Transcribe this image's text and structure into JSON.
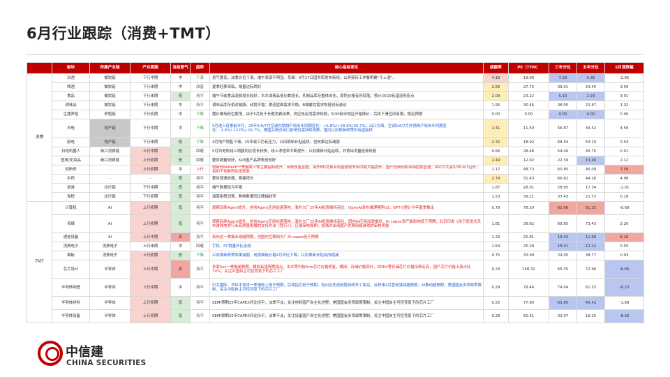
{
  "page": {
    "title": "6月行业跟踪（消费+TMT）"
  },
  "table": {
    "headers": [
      "板块",
      "所属产业链",
      "产业周期",
      "当前景气",
      "趋势",
      "核心指标变化",
      "超额率",
      "PE（TTM）",
      "三年分位",
      "五年分位",
      "5月涨跌幅"
    ],
    "sections": [
      {
        "name": "消费",
        "rows": [
          {
            "sector": "白酒",
            "chain": "餐饮链",
            "cycle": "下行中期",
            "level": "中",
            "trend": "下滑",
            "note": "景气度低，淡季价位下滑，端午表现不明显。负面：5月17日国务院发布新规，公务接待工作餐明确“不上酒”。",
            "excess": "4.18",
            "pe": "19.00",
            "p3": "7.29",
            "p5": "4.38",
            "chg": "-2.65"
          },
          {
            "sector": "啤酒",
            "chain": "餐饮链",
            "cycle": "下行末期",
            "level": "中",
            "trend": "改善",
            "note": "夏季旺季来临，销量边际转好",
            "excess": "2.66",
            "pe": "27.72",
            "p3": "39.01",
            "p5": "23.45",
            "chg": "3.59"
          },
          {
            "sector": "食品",
            "chain": "餐饮链",
            "cycle": "下行末期",
            "level": "低",
            "trend": "持平",
            "note": "端午节前食品消费增长较好，大众消费品低价数增长，乳制品库存整体去化，原奶价格有所回落；预计25Q3有望迎来拐点",
            "excess": "2.09",
            "pe": "23.22",
            "p3": "5.10",
            "p5": "2.93",
            "chg": "3.01"
          },
          {
            "sector": "调味品",
            "chain": "餐饮链",
            "cycle": "下行末期",
            "level": "中",
            "trend": "持平",
            "note": "调味品库存相对健康，动销平稳；渠道层面需求平稳，B端餐饮需求恢复较有波动",
            "excess": "1.95",
            "pe": "30.46",
            "p3": "38.05",
            "p5": "22.87",
            "chg": "1.32"
          },
          {
            "sector": "生猪养殖",
            "chain": "养殖链",
            "cycle": "下行初期",
            "level": "中",
            "trend": "下降",
            "note": "猪价维持低位震荡，由于5月处于长假消费淡季，供应充足而需求较弱，5/30部分地区开始降价，后续下滑空间有限，稳定预期",
            "excess": "0.00",
            "pe": "0.00",
            "p3": "0.00",
            "p5": "0.00",
            "chg": "0.00"
          },
          {
            "sector": "白电",
            "chain": "地产链",
            "cycle": "下行中期",
            "level": "中",
            "trend": "下降",
            "note": "5月进入旺季前半月，25年5/6/7月空调内销排产较去年同期变化：+5.8%/+28.8%/36.7%；出口方面，空调5/6/7月外销排产较去年同期变化：-1.6%/-12.0%/-16.7%。美国关税对出口影响仍需持续观察，国内以旧换新政策仍有望延续",
            "excess": "2.41",
            "pe": "11.50",
            "p3": "56.87",
            "p5": "34.52",
            "chg": "4.59"
          },
          {
            "sector": "厨电",
            "chain": "地产链",
            "cycle": "下行末期",
            "level": "低",
            "trend": "下降",
            "note": "4月地产销售下滑，25年竣工仍有压力，以旧换新补贴延续，但效果边际减弱",
            "excess": "2.32",
            "pe": "18.92",
            "p3": "68.54",
            "p5": "53.10",
            "chg": "0.54"
          },
          {
            "sector": "扫地机器人",
            "chain": "新兴消费链",
            "cycle": "上行中期",
            "level": "低",
            "trend": "回暖",
            "note": "5月扫地机线上销额同比增长较快，线上渗透率不断提升，以旧换新补贴延续，外销出货量逐渐恢复",
            "excess": "0.66",
            "pe": "28.48",
            "p3": "54.40",
            "p5": "45.75",
            "chg": "0.01"
          },
          {
            "sector": "医美/化妆品",
            "chain": "新兴消费链",
            "cycle": "上行初期",
            "level": "低",
            "trend": "回暖",
            "note": "整体销量较好，618国产品牌表现较好",
            "excess": "2.49",
            "pe": "12.92",
            "p3": "22.39",
            "p5": "13.46",
            "chg": "2.12"
          },
          {
            "sector": "创新药",
            "chain": "-",
            "cycle": "上行初期",
            "level": "中",
            "trend": "上行",
            "note": "创新药biotech一季报收入等主要指标提升，业绩改善显著，海外BD交易合同金额较去年同期大幅提升，国产创新药和出海趋势显著；ASCO大会5/30-6/3召开，有利于创新药估值修复",
            "excess": "1.17",
            "pe": "48.73",
            "p3": "60.85",
            "p5": "45.09",
            "chg": "7.58"
          },
          {
            "sector": "中药",
            "chain": "-",
            "cycle": "-",
            "level": "低",
            "trend": "持平",
            "note": "整体增速放缓，稳健增长",
            "excess": "2.74",
            "pe": "31.43",
            "p3": "66.62",
            "p5": "44.26",
            "chg": "4.98"
          },
          {
            "sector": "旅游",
            "chain": "出行链",
            "cycle": "下行中期",
            "level": "低",
            "trend": "持平",
            "note": "端午数据较为平稳",
            "excess": "1.87",
            "pe": "28.01",
            "p3": "28.85",
            "p5": "17.34",
            "chg": "-1.01"
          },
          {
            "sector": "免税",
            "chain": "出行链",
            "cycle": "下行初期",
            "level": "低",
            "trend": "持平",
            "note": "海南免税消费、购物数据同比降幅收窄",
            "excess": "1.53",
            "pe": "39.21",
            "p3": "37.43",
            "p5": "21.72",
            "chg": "0.18"
          }
        ]
      },
      {
        "name": "TMT",
        "rows": [
          {
            "sector": "计算机",
            "chain": "AI",
            "cycle": "上行初期",
            "level": "低",
            "trend": "持平",
            "note": "观察后续Agent提升，信创Agent应用加速落地，海外大厂25年AI投资维持高位，OpenAI发布推理模型o3；GPT-5预计今年夏季推出",
            "excess": "0.79",
            "pe": "78.20",
            "p3": "82.96",
            "p5": "91.25",
            "chg": "-0.68"
          },
          {
            "sector": "传媒",
            "chain": "AI",
            "cycle": "上行初期",
            "level": "低",
            "trend": "持平",
            "note": "观察后续Agent提升，信创Agent应用加速落地，海外大厂25年AI投资维持高位，国内AI应用加速推进，AI capex受产能影响低于预期；北京印发《关于促进北京市游戏电竞行业高质量发展的支持办法（暂行）》，压缩审核周期，加强对出海国产优质网络游戏的审核奖励",
            "excess": "1.81",
            "pe": "39.62",
            "p3": "69.85",
            "p5": "73.43",
            "chg": "2.20"
          },
          {
            "sector": "通信设备",
            "chain": "AI",
            "cycle": "上行中期",
            "level": "高",
            "trend": "持平",
            "note": "英伟达一季报业绩超预期，但国内互联网大厂AI capex低于预期",
            "excess": "1.29",
            "pe": "25.81",
            "p3": "19.44",
            "p5": "11.68",
            "chg": "6.26"
          },
          {
            "sector": "消费电子",
            "chain": "消费电子",
            "cycle": "上行末期",
            "level": "中",
            "trend": "回暖",
            "note": "手机、PC销量环比走弱",
            "excess": "1.64",
            "pe": "25.28",
            "p3": "18.41",
            "p5": "12.22",
            "chg": "0.55"
          },
          {
            "sector": "面板",
            "chain": "消费电子",
            "cycle": "上行初期",
            "level": "低",
            "trend": "下降",
            "note": "以旧换新政策效果减弱，电视面板价格4月环比下降，以旧换新补贴有所缩减",
            "excess": "0.75",
            "pe": "33.99",
            "p3": "29.05",
            "p5": "38.77",
            "chg": "0.93"
          },
          {
            "sector": "芯片设计",
            "chain": "半导体",
            "cycle": "上行中期",
            "level": "高",
            "trend": "持平",
            "note": "多家Soc一季报超预期，模拟有望周期拐点，水木等科技Arm芯片价格修复，模拟、存储价格回升，DDR4等存储芯片价格持续走高，国产芯片价格上涨占比 70%；关注中国自主可控背景下的芯片工厂",
            "excess": "0.24",
            "pe": "148.32",
            "p3": "66.35",
            "p5": "72.96",
            "chg": "-6.66"
          },
          {
            "sector": "半导体制造",
            "chain": "半导体",
            "cycle": "上行中期",
            "level": "中",
            "trend": "持平",
            "note": "中芯国际、华虹半导体一季报收入低于预期，后续指引低于预期，但AI及先进制程持续开工率高；台积电4月营收强劲超预期，AI推动超预期；美国国会多项政策限制，关注中国自主可控背景下的芯片工厂",
            "excess": "0.29",
            "pe": "79.44",
            "p3": "74.04",
            "p5": "61.32",
            "chg": "-6.23"
          },
          {
            "sector": "半导体材料",
            "chain": "半导体",
            "cycle": "上行初期",
            "level": "低",
            "trend": "持平",
            "note": "SEMI预期25年CAPEX环比持平，淡季不淡，关注材料国产自主化进程；美国国会多项政策限制，关注中国自主可控背景下的芯片工厂",
            "excess": "0.55",
            "pe": "77.90",
            "p3": "65.80",
            "p5": "45.42",
            "chg": "-1.69"
          },
          {
            "sector": "半导体设备",
            "chain": "半导体",
            "cycle": "上行初期",
            "level": "低",
            "trend": "持平",
            "note": "SEMI预期25年CAPEX环比持平，淡季不淡，关注设备国产自主化进程；美国国会多项政策限制，关注中国自主可控背景下的芯片工厂",
            "excess": "0.28",
            "pe": "50.31",
            "p3": "32.07",
            "p5": "19.25",
            "chg": "-6.26"
          }
        ]
      }
    ]
  },
  "logo": {
    "cn": "中信建",
    "en": "CHINA SECURITIES"
  },
  "colors": {
    "header_red": "#c00000",
    "light_red": "#f9d3cf",
    "yellow": "#fbefb7",
    "gray": "#c8c8c8",
    "blue": "#b9c6ef"
  }
}
